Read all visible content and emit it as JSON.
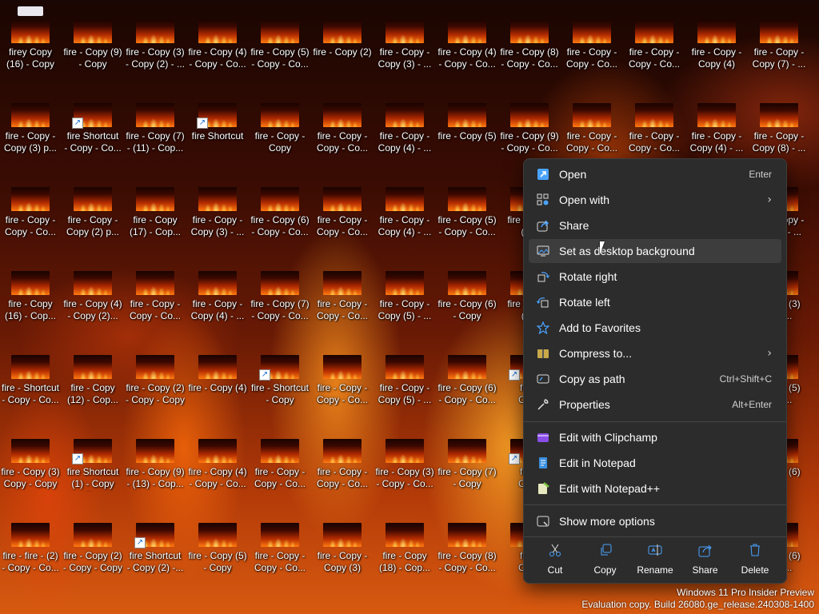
{
  "desktop": {
    "rows": [
      [
        "firey Copy\n(16) - Copy",
        "fire - Copy (9)\n- Copy",
        "fire - Copy (3)\n- Copy (2) - ...",
        "fire - Copy (4)\n- Copy - Co...",
        "fire - Copy (5)\n- Copy - Co...",
        "fire - Copy (2)",
        "fire - Copy -\nCopy (3) - ...",
        "fire - Copy (4)\n- Copy - Co...",
        "fire - Copy (8)\n- Copy - Co...",
        "fire - Copy -\nCopy - Co...",
        "fire - Copy -\nCopy - Co...",
        "fire - Copy -\nCopy (4)",
        "fire - Copy -\nCopy (7) - ..."
      ],
      [
        "fire - Copy -\nCopy (3) p...",
        "fire Shortcut\n- Copy - Co...",
        "fire - Copy (7)\n- (11) - Cop...",
        "fire Shortcut",
        "fire - Copy -\nCopy",
        "fire - Copy -\nCopy - Co...",
        "fire - Copy -\nCopy (4) - ...",
        "fire - Copy (5)",
        "fire - Copy (9)\n- Copy - Co...",
        "fire - Copy -\nCopy - Co...",
        "fire - Copy -\nCopy - Co...",
        "fire - Copy -\nCopy (4) - ...",
        "fire - Copy -\nCopy (8) - ..."
      ],
      [
        "fire - Copy -\nCopy - Co...",
        "fire - Copy -\nCopy (2) p...",
        "fire - Copy\n(17) - Cop...",
        "fire - Copy -\nCopy (3) - ...",
        "fire - Copy (6)\n- Copy - Co...",
        "fire - Copy -\nCopy - Co...",
        "fire - Copy -\nCopy (4) - ...",
        "fire - Copy (5)\n- Copy - Co...",
        "fire - Copy\n(10)",
        "",
        "",
        "",
        "fire - Copy -\n- Copy - ..."
      ],
      [
        "fire - Copy\n(16) - Cop...",
        "fire - Copy (4)\n- Copy (2)...",
        "fire - Copy -\nCopy - Co...",
        "fire - Copy -\nCopy (4) - ...",
        "fire - Copy (7)\n- Copy - Co...",
        "fire - Copy -\nCopy - Co...",
        "fire - Copy -\nCopy (5) - ...",
        "fire - Copy (6)\n- Copy",
        "fire - Copy\n(11)",
        "",
        "",
        "",
        "- Copy (3)\n- Co..."
      ],
      [
        "fire - Shortcut\n- Copy - Co...",
        "fire - Copy\n(12) - Cop...",
        "fire - Copy (2)\n- Copy - Copy",
        "fire - Copy (4)",
        "fire - Shortcut\n- Copy",
        "fire - Copy -\nCopy - Co...",
        "fire - Copy -\nCopy (5) - ...",
        "fire - Copy (6)\n- Copy - Co...",
        "fire -\nCopy",
        "",
        "",
        "",
        "- Copy (5)\n- Co..."
      ],
      [
        "fire - Copy (3)\nCopy - Copy",
        "fire Shortcut\n(1) - Copy (3)...",
        "fire - Copy (9)\n- (13) - Cop...",
        "fire - Copy (4)\n- Copy - Co...",
        "fire - Copy -\nCopy - Co...",
        "fire - Copy -\nCopy - Co...",
        "fire - Copy (3)\n- Copy - Co...",
        "fire - Copy (7)\n- Copy",
        "fire -\nCopy",
        "",
        "",
        "",
        "- Copy (6)"
      ],
      [
        "fire - fire - (2)\n- Copy - Co...",
        "fire - Copy (2)\n- Copy - Copy",
        "fire Shortcut\n- Copy (2) -...",
        "fire - Copy (5)\n- Copy",
        "fire - Copy -\nCopy - Co...",
        "fire - Copy -\nCopy (3)",
        "fire - Copy\n(18) - Cop...",
        "fire - Copy (8)\n- Copy - Co...",
        "fire -\nCopy",
        "",
        "",
        "",
        "- Copy (6)\n- Co..."
      ]
    ],
    "shortcut_cells": [
      [
        1,
        1
      ],
      [
        1,
        3
      ],
      [
        4,
        4
      ],
      [
        4,
        8
      ],
      [
        5,
        1
      ],
      [
        5,
        8
      ],
      [
        6,
        2
      ]
    ]
  },
  "context_menu": {
    "items": [
      {
        "icon": "open-icon",
        "label": "Open",
        "shortcut": "Enter",
        "submenu": false
      },
      {
        "icon": "open-with-icon",
        "label": "Open with",
        "shortcut": "",
        "submenu": true
      },
      {
        "icon": "share-icon",
        "label": "Share",
        "shortcut": "",
        "submenu": false
      },
      {
        "icon": "desktop-background-icon",
        "label": "Set as desktop background",
        "shortcut": "",
        "submenu": false
      },
      {
        "icon": "rotate-right-icon",
        "label": "Rotate right",
        "shortcut": "",
        "submenu": false
      },
      {
        "icon": "rotate-left-icon",
        "label": "Rotate left",
        "shortcut": "",
        "submenu": false
      },
      {
        "icon": "star-icon",
        "label": "Add to Favorites",
        "shortcut": "",
        "submenu": false
      },
      {
        "icon": "compress-icon",
        "label": "Compress to...",
        "shortcut": "",
        "submenu": true
      },
      {
        "icon": "copy-path-icon",
        "label": "Copy as path",
        "shortcut": "Ctrl+Shift+C",
        "submenu": false
      },
      {
        "icon": "wrench-icon",
        "label": "Properties",
        "shortcut": "Alt+Enter",
        "submenu": false
      },
      {
        "icon": "clipchamp-icon",
        "label": "Edit with Clipchamp",
        "shortcut": "",
        "submenu": false
      },
      {
        "icon": "notepad-icon",
        "label": "Edit in Notepad",
        "shortcut": "",
        "submenu": false
      },
      {
        "icon": "notepadpp-icon",
        "label": "Edit with Notepad++",
        "shortcut": "",
        "submenu": false
      },
      {
        "icon": "more-options-icon",
        "label": "Show more options",
        "shortcut": "",
        "submenu": false
      }
    ],
    "hovered_item": "Set as desktop background",
    "actions": [
      {
        "icon": "cut-icon",
        "label": "Cut"
      },
      {
        "icon": "copy-icon",
        "label": "Copy"
      },
      {
        "icon": "rename-icon",
        "label": "Rename"
      },
      {
        "icon": "share-icon",
        "label": "Share"
      },
      {
        "icon": "delete-icon",
        "label": "Delete"
      }
    ]
  },
  "watermark": {
    "line1": "Windows 11 Pro Insider Preview",
    "line2": "Evaluation copy. Build 26080.ge_release.240308-1400"
  },
  "colors": {
    "menu_bg": "#2c2c2c",
    "menu_hover": "#3d3d3d",
    "accent_blue": "#4aa3ff"
  }
}
